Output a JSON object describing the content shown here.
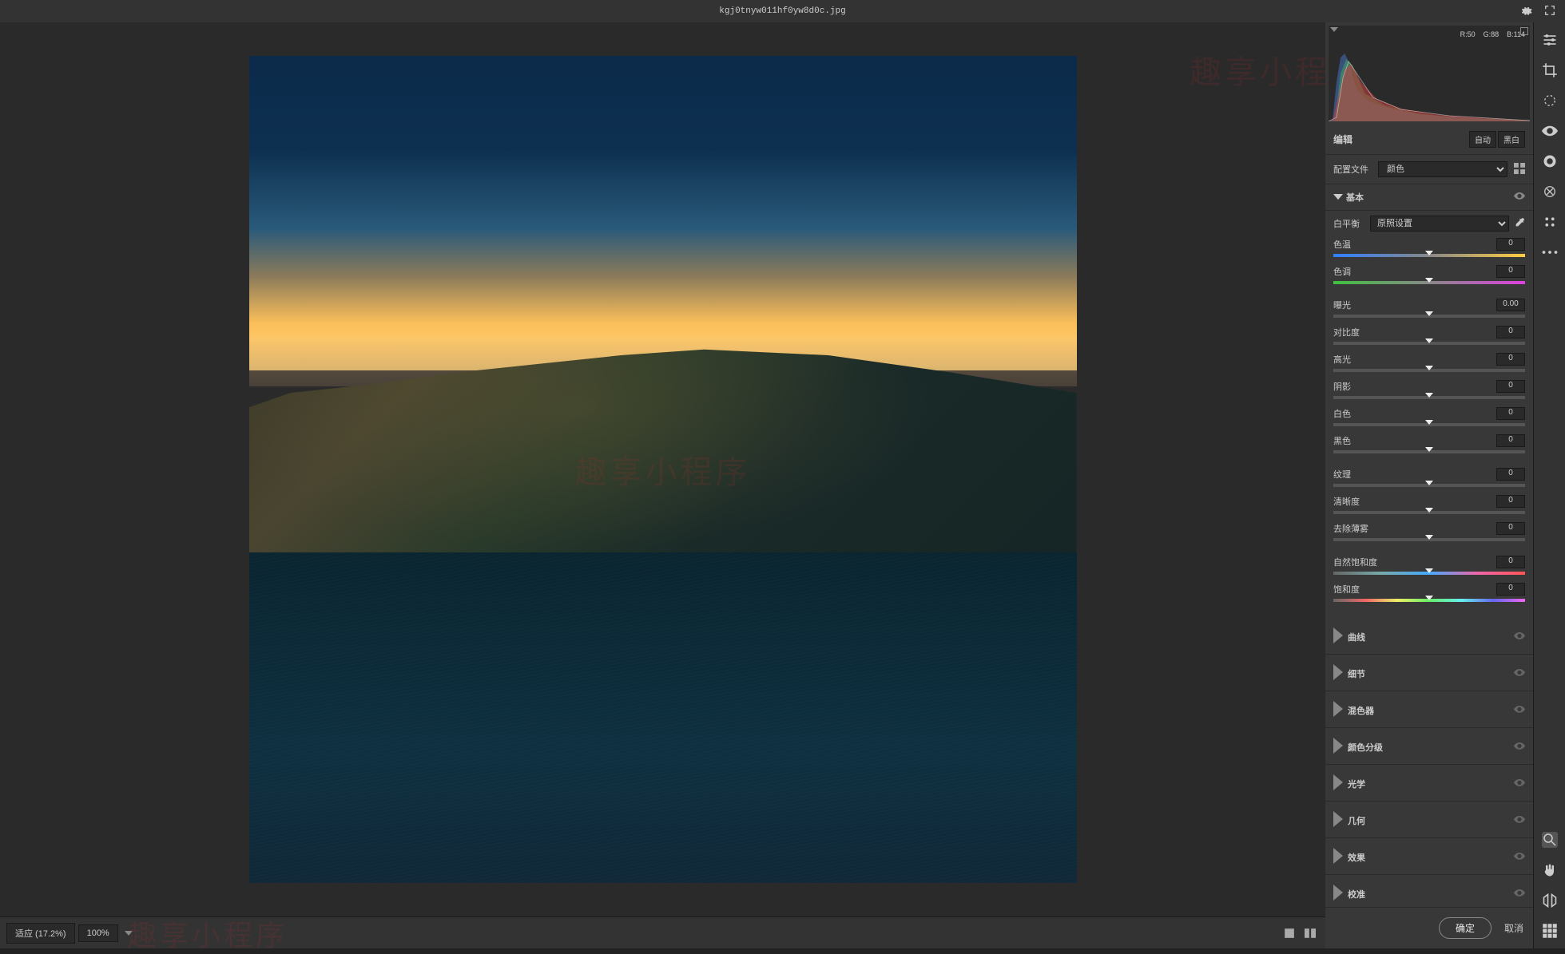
{
  "titlebar": {
    "filename": "kgj0tnyw011hf0yw8d0c.jpg"
  },
  "watermark_text": "趣享小程序",
  "histogram": {
    "r_label": "R:",
    "r_val": "50",
    "g_label": "G:",
    "g_val": "88",
    "b_label": "B:",
    "b_val": "114"
  },
  "edit": {
    "title": "编辑",
    "auto": "自动",
    "bw": "黑白"
  },
  "profile": {
    "label": "配置文件",
    "value": "颜色"
  },
  "basic": {
    "title": "基本",
    "wb_label": "白平衡",
    "wb_value": "原照设置",
    "sliders": [
      {
        "label": "色温",
        "value": "0",
        "track": "temp"
      },
      {
        "label": "色调",
        "value": "0",
        "track": "tint"
      }
    ],
    "sliders2": [
      {
        "label": "曝光",
        "value": "0.00",
        "track": ""
      },
      {
        "label": "对比度",
        "value": "0",
        "track": ""
      },
      {
        "label": "高光",
        "value": "0",
        "track": ""
      },
      {
        "label": "阴影",
        "value": "0",
        "track": ""
      },
      {
        "label": "白色",
        "value": "0",
        "track": ""
      },
      {
        "label": "黑色",
        "value": "0",
        "track": ""
      }
    ],
    "sliders3": [
      {
        "label": "纹理",
        "value": "0",
        "track": ""
      },
      {
        "label": "清晰度",
        "value": "0",
        "track": ""
      },
      {
        "label": "去除薄雾",
        "value": "0",
        "track": ""
      }
    ],
    "sliders4": [
      {
        "label": "自然饱和度",
        "value": "0",
        "track": "vibrance"
      },
      {
        "label": "饱和度",
        "value": "0",
        "track": "saturation"
      }
    ]
  },
  "collapsed_sections": [
    "曲线",
    "细节",
    "混色器",
    "颜色分级",
    "光学",
    "几何",
    "效果",
    "校准"
  ],
  "zoom": {
    "fit_label": "适应 (17.2%)",
    "hundred": "100%"
  },
  "actions": {
    "ok": "确定",
    "cancel": "取消"
  }
}
